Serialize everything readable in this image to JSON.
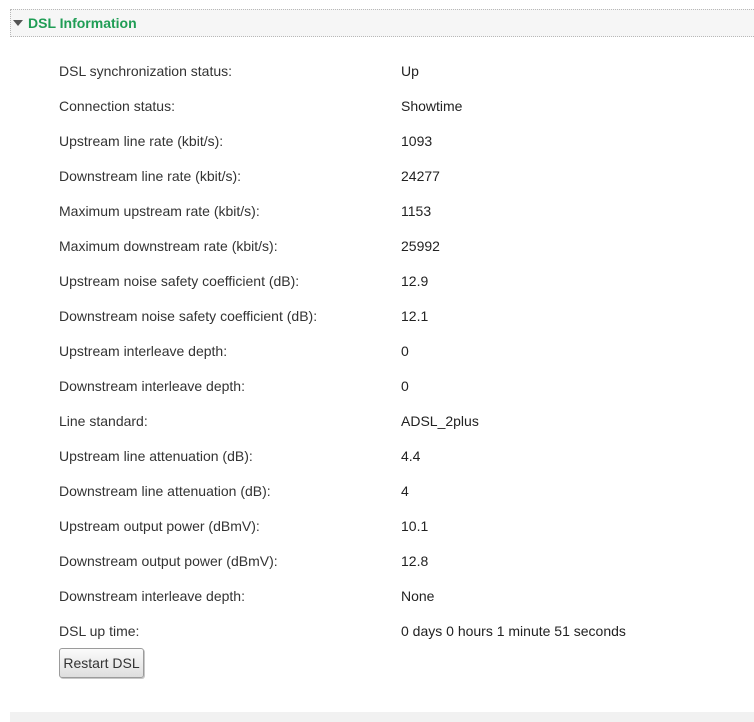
{
  "section": {
    "title": "DSL Information"
  },
  "rows": [
    {
      "label": "DSL synchronization status:",
      "value": "Up"
    },
    {
      "label": "Connection status:",
      "value": "Showtime"
    },
    {
      "label": "Upstream line rate (kbit/s):",
      "value": "1093"
    },
    {
      "label": "Downstream line rate (kbit/s):",
      "value": "24277"
    },
    {
      "label": "Maximum upstream rate (kbit/s):",
      "value": "1153"
    },
    {
      "label": "Maximum downstream rate (kbit/s):",
      "value": "25992"
    },
    {
      "label": "Upstream noise safety coefficient (dB):",
      "value": "12.9"
    },
    {
      "label": "Downstream noise safety coefficient (dB):",
      "value": "12.1"
    },
    {
      "label": "Upstream interleave depth:",
      "value": "0"
    },
    {
      "label": "Downstream interleave depth:",
      "value": "0"
    },
    {
      "label": "Line standard:",
      "value": "ADSL_2plus"
    },
    {
      "label": "Upstream line attenuation (dB):",
      "value": "4.4"
    },
    {
      "label": "Downstream line attenuation (dB):",
      "value": "4"
    },
    {
      "label": "Upstream output power (dBmV):",
      "value": "10.1"
    },
    {
      "label": "Downstream output power (dBmV):",
      "value": "12.8"
    },
    {
      "label": "Downstream interleave depth:",
      "value": "None"
    },
    {
      "label": "DSL up time:",
      "value": "0 days 0 hours 1 minute 51 seconds"
    }
  ],
  "actions": {
    "restart_label": "Restart DSL"
  },
  "icons": {
    "toggle": "triangle-down-icon"
  },
  "colors": {
    "section_title": "#1f9d55"
  }
}
